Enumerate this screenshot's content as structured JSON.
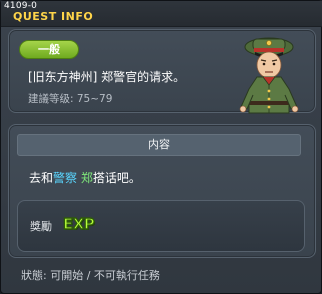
{
  "window": {
    "quest_id": "4109-0",
    "title": "QUEST INFO"
  },
  "summary": {
    "badge": "一般",
    "quest_name": "[旧东方神州] 郑警官的请求。",
    "level_label": "建議等级: 75~79"
  },
  "npc": {
    "icon": "officer-npc-portrait"
  },
  "content": {
    "header": "内容",
    "desc_prefix": "去和",
    "desc_blue": "警察",
    "desc_space": " ",
    "desc_green": "郑",
    "desc_suffix": "搭话吧。"
  },
  "reward": {
    "label": "獎勵",
    "exp_text": "EXP"
  },
  "status": {
    "text": "狀態: 可開始 / 不可執行任務"
  },
  "colors": {
    "title": "#ffd54a",
    "badge": "#8cc236",
    "highlight_blue": "#5ad6ff",
    "highlight_green": "#7fe87a",
    "exp": "#b6ff3a"
  }
}
